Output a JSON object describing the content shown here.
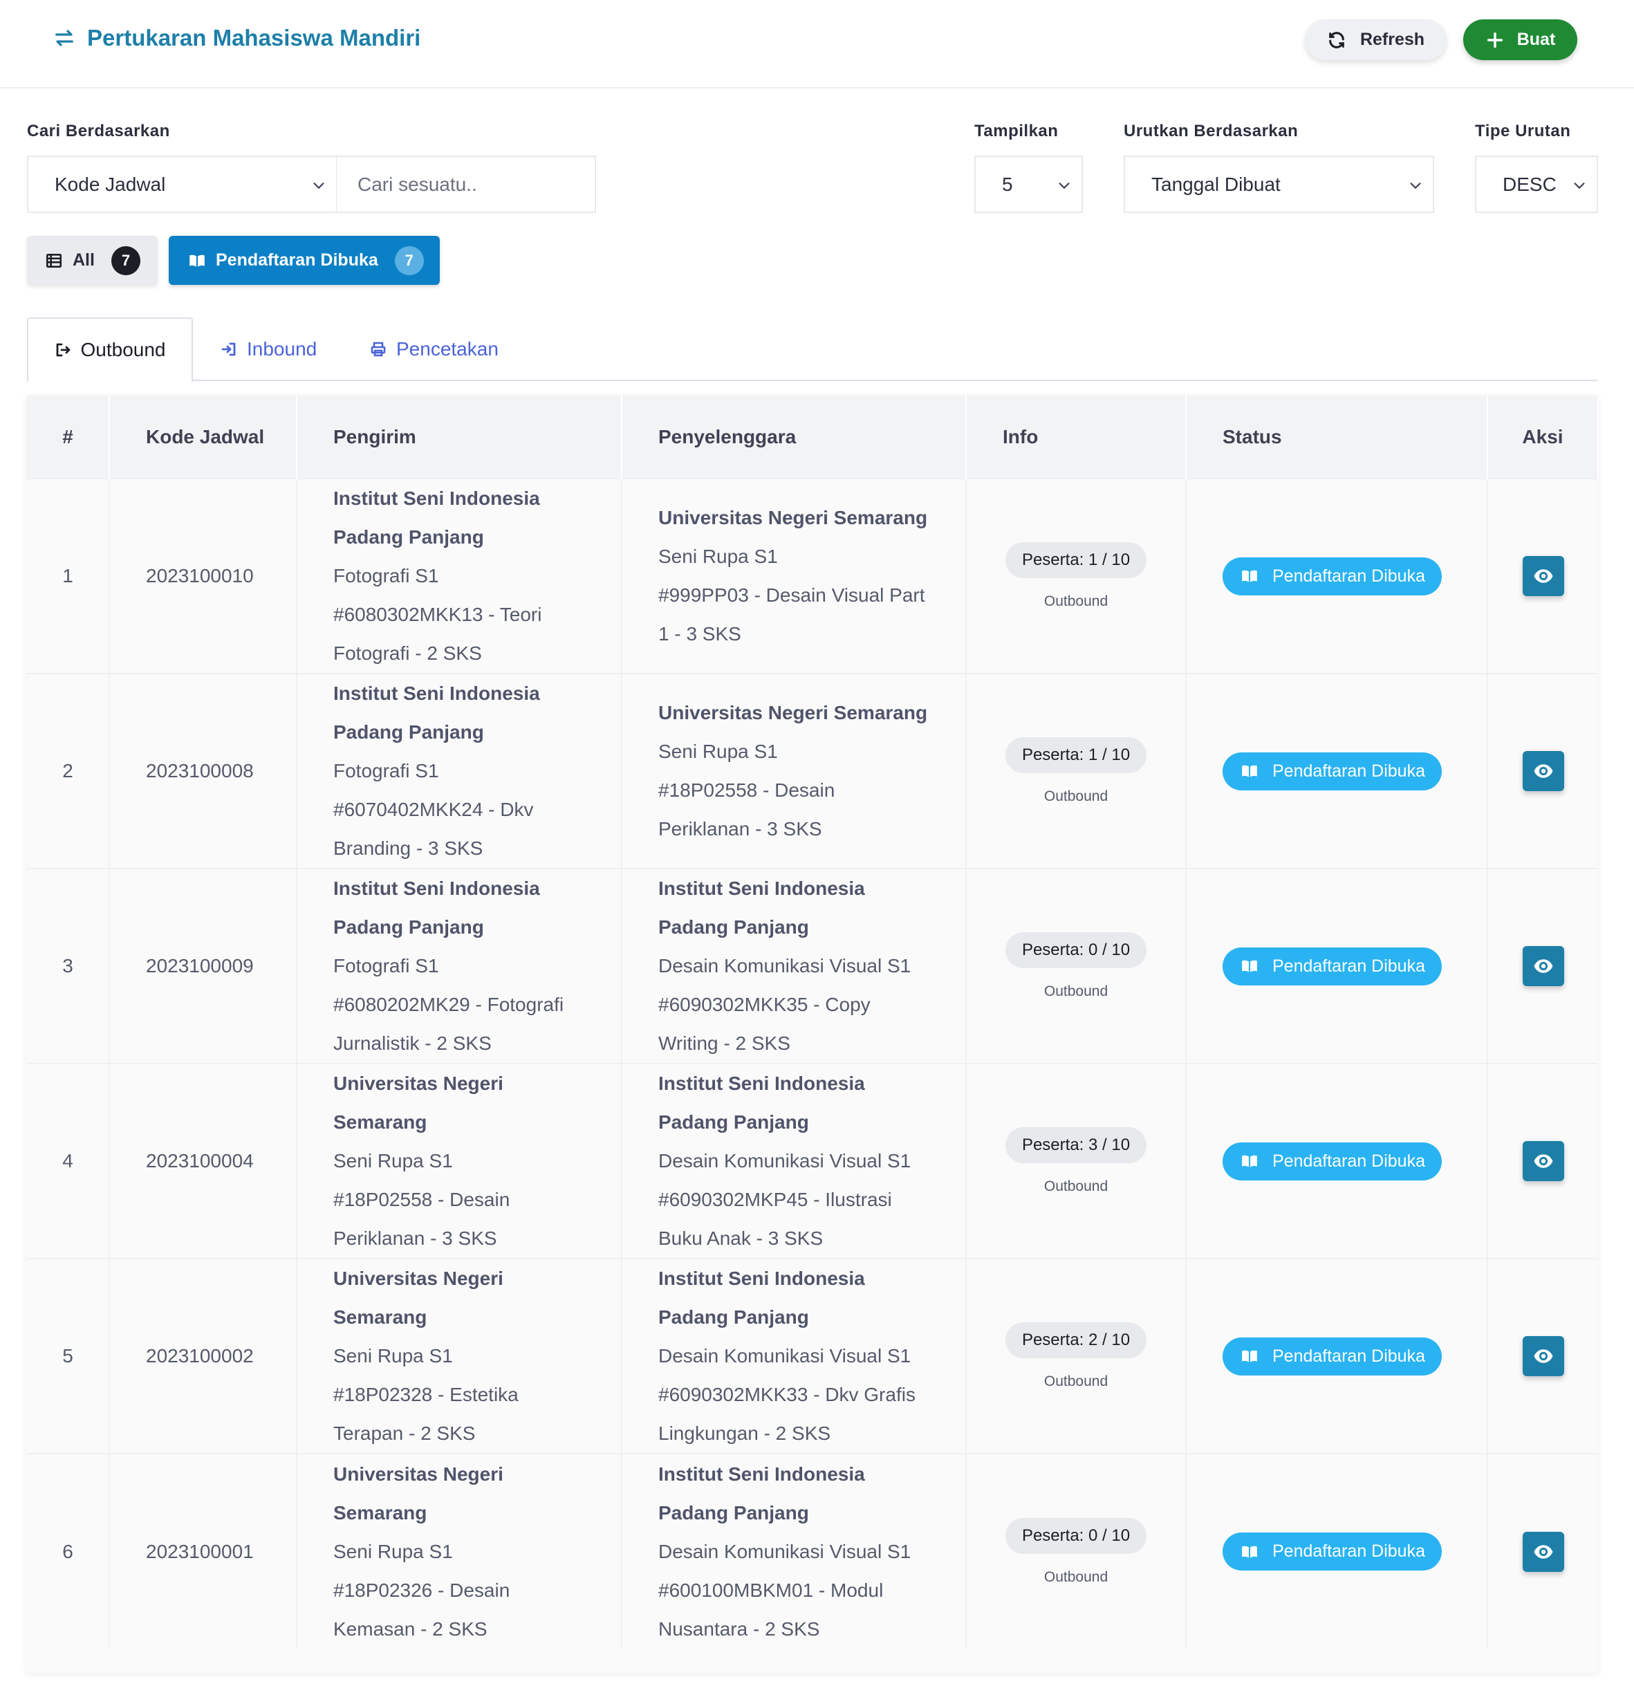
{
  "header": {
    "title": "Pertukaran Mahasiswa Mandiri",
    "refresh_label": "Refresh",
    "create_label": "Buat"
  },
  "filters": {
    "search_by_label": "Cari Berdasarkan",
    "search_by_value": "Kode Jadwal",
    "search_placeholder": "Cari sesuatu..",
    "show_label": "Tampilkan",
    "show_value": "5",
    "sort_by_label": "Urutkan Berdasarkan",
    "sort_by_value": "Tanggal Dibuat",
    "sort_type_label": "Tipe Urutan",
    "sort_type_value": "DESC"
  },
  "status_filters": {
    "all_label": "All",
    "all_count": "7",
    "open_label": "Pendaftaran Dibuka",
    "open_count": "7"
  },
  "tabs": {
    "outbound": "Outbound",
    "inbound": "Inbound",
    "print": "Pencetakan"
  },
  "table": {
    "headers": [
      "#",
      "Kode Jadwal",
      "Pengirim",
      "Penyelenggara",
      "Info",
      "Status",
      "Aksi"
    ],
    "rows": [
      {
        "no": "1",
        "code": "2023100010",
        "sender_inst_1": "Institut Seni Indonesia",
        "sender_inst_2": "Padang Panjang",
        "sender_prog": "Fotografi S1",
        "sender_course_1": "#6080302MKK13 - Teori",
        "sender_course_2": "Fotografi - 2 SKS",
        "host_inst_1": "Universitas Negeri Semarang",
        "host_inst_2": "",
        "host_prog": "Seni Rupa S1",
        "host_course_1": "#999PP03 - Desain Visual Part",
        "host_course_2": "1 - 3 SKS",
        "participants": "Peserta: 1 / 10",
        "direction": "Outbound",
        "status": "Pendaftaran Dibuka"
      },
      {
        "no": "2",
        "code": "2023100008",
        "sender_inst_1": "Institut Seni Indonesia",
        "sender_inst_2": "Padang Panjang",
        "sender_prog": "Fotografi S1",
        "sender_course_1": "#6070402MKK24 - Dkv",
        "sender_course_2": "Branding - 3 SKS",
        "host_inst_1": "Universitas Negeri Semarang",
        "host_inst_2": "",
        "host_prog": "Seni Rupa S1",
        "host_course_1": "#18P02558 - Desain",
        "host_course_2": "Periklanan - 3 SKS",
        "participants": "Peserta: 1 / 10",
        "direction": "Outbound",
        "status": "Pendaftaran Dibuka"
      },
      {
        "no": "3",
        "code": "2023100009",
        "sender_inst_1": "Institut Seni Indonesia",
        "sender_inst_2": "Padang Panjang",
        "sender_prog": "Fotografi S1",
        "sender_course_1": "#6080202MK29 - Fotografi",
        "sender_course_2": "Jurnalistik - 2 SKS",
        "host_inst_1": "Institut Seni Indonesia",
        "host_inst_2": "Padang Panjang",
        "host_prog": "Desain Komunikasi Visual S1",
        "host_course_1": "#6090302MKK35 - Copy",
        "host_course_2": "Writing - 2 SKS",
        "participants": "Peserta: 0 / 10",
        "direction": "Outbound",
        "status": "Pendaftaran Dibuka"
      },
      {
        "no": "4",
        "code": "2023100004",
        "sender_inst_1": "Universitas Negeri",
        "sender_inst_2": "Semarang",
        "sender_prog": "Seni Rupa S1",
        "sender_course_1": "#18P02558 - Desain",
        "sender_course_2": "Periklanan - 3 SKS",
        "host_inst_1": "Institut Seni Indonesia",
        "host_inst_2": "Padang Panjang",
        "host_prog": "Desain Komunikasi Visual S1",
        "host_course_1": "#6090302MKP45 - Ilustrasi",
        "host_course_2": "Buku Anak - 3 SKS",
        "participants": "Peserta: 3 / 10",
        "direction": "Outbound",
        "status": "Pendaftaran Dibuka"
      },
      {
        "no": "5",
        "code": "2023100002",
        "sender_inst_1": "Universitas Negeri",
        "sender_inst_2": "Semarang",
        "sender_prog": "Seni Rupa S1",
        "sender_course_1": "#18P02328 - Estetika",
        "sender_course_2": "Terapan - 2 SKS",
        "host_inst_1": "Institut Seni Indonesia",
        "host_inst_2": "Padang Panjang",
        "host_prog": "Desain Komunikasi Visual S1",
        "host_course_1": "#6090302MKK33 - Dkv Grafis",
        "host_course_2": "Lingkungan - 2 SKS",
        "participants": "Peserta: 2 / 10",
        "direction": "Outbound",
        "status": "Pendaftaran Dibuka"
      },
      {
        "no": "6",
        "code": "2023100001",
        "sender_inst_1": "Universitas Negeri",
        "sender_inst_2": "Semarang",
        "sender_prog": "Seni Rupa S1",
        "sender_course_1": "#18P02326 - Desain",
        "sender_course_2": "Kemasan - 2 SKS",
        "host_inst_1": "Institut Seni Indonesia",
        "host_inst_2": "Padang Panjang",
        "host_prog": "Desain Komunikasi Visual S1",
        "host_course_1": "#600100MBKM01 - Modul",
        "host_course_2": "Nusantara - 2 SKS",
        "participants": "Peserta: 0 / 10",
        "direction": "Outbound",
        "status": "Pendaftaran Dibuka"
      }
    ]
  },
  "colors": {
    "primary": "#1d7fa8",
    "success": "#1f8a33",
    "info": "#2ab3f2",
    "active_filter": "#0b80c6"
  },
  "icons": {
    "title": "exchange-icon",
    "refresh": "refresh-icon",
    "create": "plus-icon",
    "all": "list-icon",
    "open": "book-open-icon",
    "outbound": "sign-out-icon",
    "inbound": "sign-in-icon",
    "print": "print-icon",
    "view": "eye-icon"
  }
}
